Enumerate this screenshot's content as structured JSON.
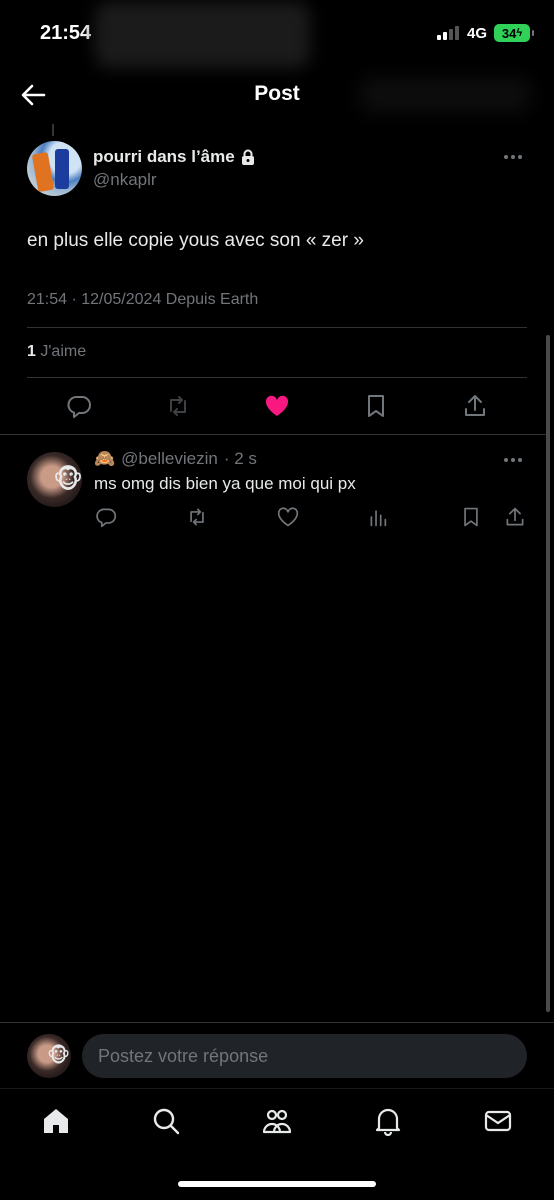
{
  "status_bar": {
    "time": "21:54",
    "network": "4G",
    "battery": "34"
  },
  "header": {
    "title": "Post"
  },
  "post": {
    "display_name": "pourri dans l’âme",
    "handle": "@nkaplr",
    "text": "en plus elle copie yous avec son « zer »",
    "meta": "21:54 · 12/05/2024 Depuis Earth",
    "likes_count": "1",
    "likes_label": "J'aime",
    "liked": true,
    "like_color": "#f91880"
  },
  "reply": {
    "emoji": "🙈",
    "handle": "@belleviezin",
    "time": "· 2 s",
    "text": "ms omg dis bien ya que moi qui px"
  },
  "composer": {
    "placeholder": "Postez votre réponse"
  },
  "icons": {
    "back": "arrow-left-icon",
    "lock": "lock-icon",
    "reply": "comment-icon",
    "repost": "repost-icon",
    "like": "heart-icon",
    "bookmark": "bookmark-icon",
    "share": "share-icon",
    "views": "analytics-icon",
    "home": "home-icon",
    "search": "search-icon",
    "communities": "people-icon",
    "notifications": "bell-icon",
    "messages": "mail-icon"
  }
}
